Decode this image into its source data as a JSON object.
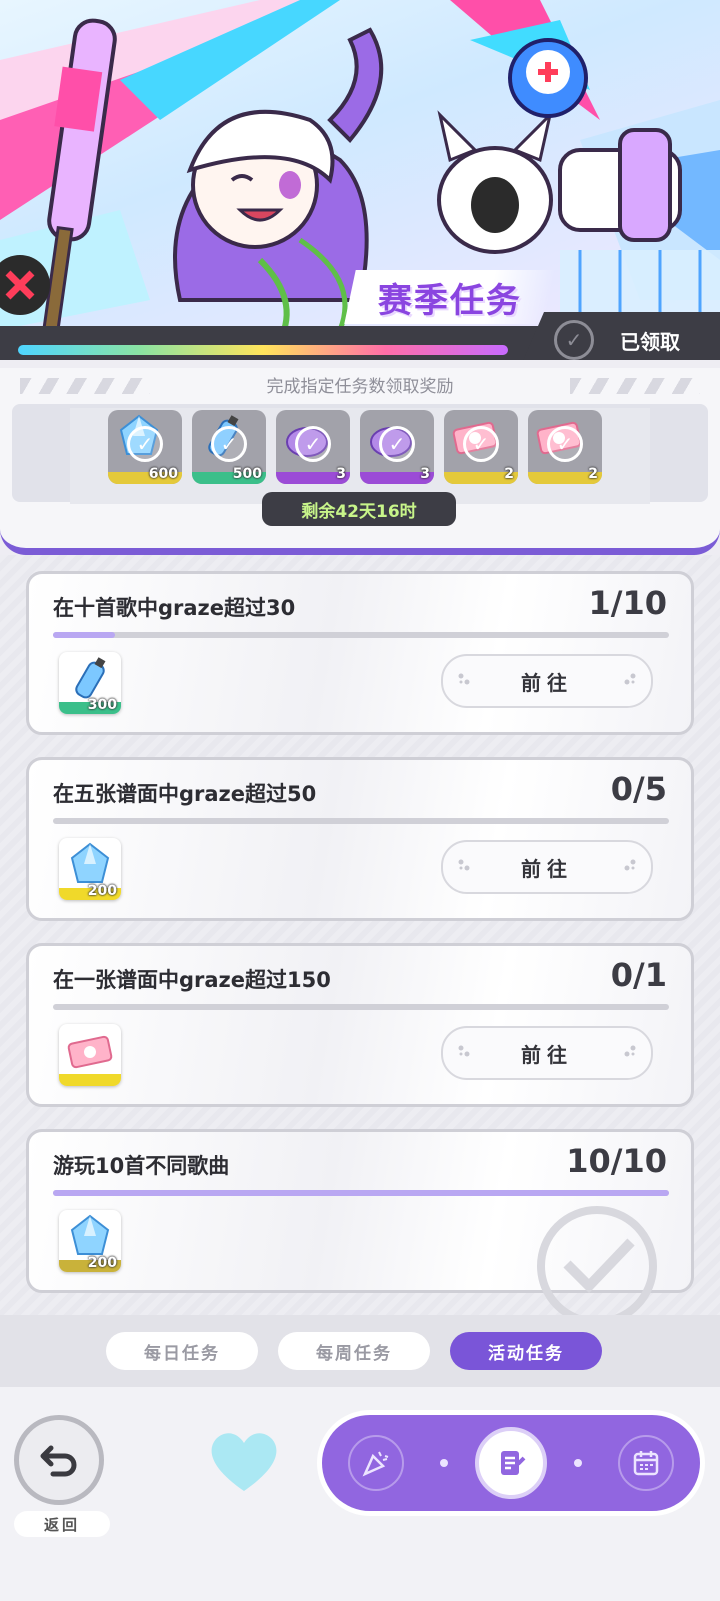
{
  "banner": {
    "title": "赛季任务",
    "claimed_label": "已领取",
    "season_progress": 1.0
  },
  "rewards_panel": {
    "hint": "完成指定任务数领取奖励",
    "remaining_time": "剩余42天16时",
    "rewards": [
      {
        "qty": "600",
        "icon": "crystal-icon",
        "base_color": "#e4c93a",
        "claimed": true
      },
      {
        "qty": "500",
        "icon": "bottle-icon",
        "base_color": "#3bbf8a",
        "claimed": true
      },
      {
        "qty": "3",
        "icon": "pot-icon",
        "base_color": "#9b4bd6",
        "claimed": true
      },
      {
        "qty": "3",
        "icon": "pot-icon",
        "base_color": "#9b4bd6",
        "claimed": true
      },
      {
        "qty": "2",
        "icon": "ticket-icon",
        "base_color": "#e4c93a",
        "claimed": true
      },
      {
        "qty": "2",
        "icon": "ticket-icon",
        "base_color": "#e4c93a",
        "claimed": true
      }
    ]
  },
  "tasks": [
    {
      "title": "在十首歌中graze超过30",
      "progress": "1/10",
      "fraction": 0.1,
      "reward_qty": "300",
      "reward_icon": "bottle-icon",
      "base_color": "#3bbf8a",
      "button": "前往",
      "done": false
    },
    {
      "title": "在五张谱面中graze超过50",
      "progress": "0/5",
      "fraction": 0.0,
      "reward_qty": "200",
      "reward_icon": "crystal-icon",
      "base_color": "#f0d92a",
      "button": "前往",
      "done": false
    },
    {
      "title": "在一张谱面中graze超过150",
      "progress": "0/1",
      "fraction": 0.0,
      "reward_qty": "",
      "reward_icon": "ticket-icon",
      "base_color": "#f0d92a",
      "button": "前往",
      "done": false
    },
    {
      "title": "游玩10首不同歌曲",
      "progress": "10/10",
      "fraction": 1.0,
      "reward_qty": "200",
      "reward_icon": "crystal-icon",
      "base_color": "#c9b23a",
      "button": "",
      "done": true
    }
  ],
  "tabs": [
    {
      "label": "每日任务",
      "active": false
    },
    {
      "label": "每周任务",
      "active": false
    },
    {
      "label": "活动任务",
      "active": true
    }
  ],
  "nav": {
    "back_label": "返回",
    "items": [
      "party-popper-icon",
      "task-note-icon",
      "calendar-icon"
    ],
    "active_index": 1
  }
}
